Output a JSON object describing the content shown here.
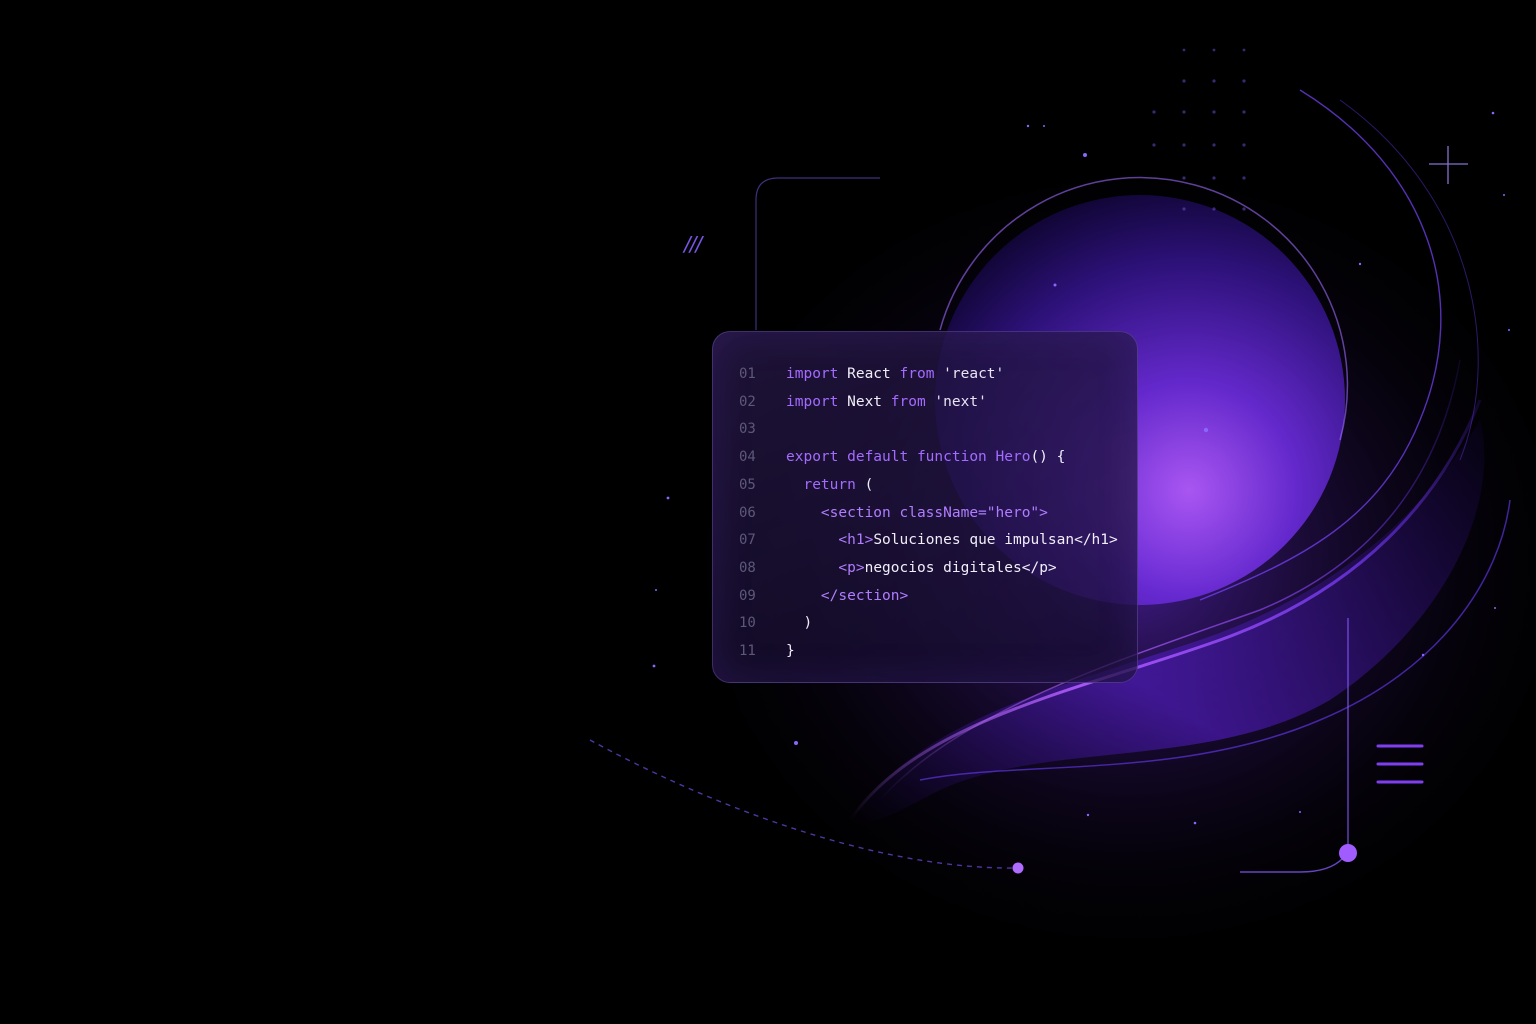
{
  "decor": {
    "slashes": "///"
  },
  "code_card": {
    "lines": [
      {
        "num": "01",
        "tokens": [
          {
            "t": "import",
            "c": "kw"
          },
          {
            "t": " React ",
            "c": "txt"
          },
          {
            "t": "from",
            "c": "kw"
          },
          {
            "t": " 'react'",
            "c": "str"
          }
        ]
      },
      {
        "num": "02",
        "tokens": [
          {
            "t": "import",
            "c": "kw"
          },
          {
            "t": " Next ",
            "c": "txt"
          },
          {
            "t": "from",
            "c": "kw"
          },
          {
            "t": " 'next'",
            "c": "str"
          }
        ]
      },
      {
        "num": "03",
        "tokens": []
      },
      {
        "num": "04",
        "tokens": [
          {
            "t": "export default function",
            "c": "kw"
          },
          {
            "t": " ",
            "c": "txt"
          },
          {
            "t": "Hero",
            "c": "kw"
          },
          {
            "t": "() {",
            "c": "txt"
          }
        ]
      },
      {
        "num": "05",
        "tokens": [
          {
            "t": "  ",
            "c": "txt"
          },
          {
            "t": "return",
            "c": "kw"
          },
          {
            "t": " (",
            "c": "txt"
          }
        ]
      },
      {
        "num": "06",
        "tokens": [
          {
            "t": "    ",
            "c": "txt"
          },
          {
            "t": "<section className=\"hero\">",
            "c": "tag"
          }
        ]
      },
      {
        "num": "07",
        "tokens": [
          {
            "t": "      ",
            "c": "txt"
          },
          {
            "t": "<h1>",
            "c": "tag"
          },
          {
            "t": "Soluciones que impulsan</h1>",
            "c": "txt"
          }
        ]
      },
      {
        "num": "08",
        "tokens": [
          {
            "t": "      ",
            "c": "txt"
          },
          {
            "t": "<p>",
            "c": "tag"
          },
          {
            "t": "negocios digitales</p>",
            "c": "txt"
          }
        ]
      },
      {
        "num": "09",
        "tokens": [
          {
            "t": "    ",
            "c": "txt"
          },
          {
            "t": "</section>",
            "c": "tag"
          }
        ]
      },
      {
        "num": "10",
        "tokens": [
          {
            "t": "  )",
            "c": "txt"
          }
        ]
      },
      {
        "num": "11",
        "tokens": [
          {
            "t": "}",
            "c": "txt"
          }
        ]
      }
    ]
  },
  "colors": {
    "background": "#000000",
    "accent": "#8b4dff",
    "keyword": "#a36bff",
    "line_number": "#5e5878"
  }
}
